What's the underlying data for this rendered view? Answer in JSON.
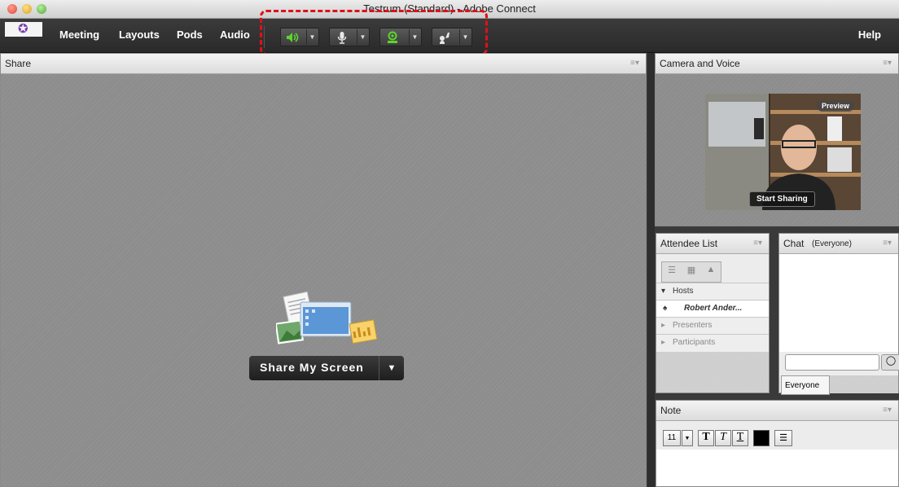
{
  "window": {
    "title": "Testrum (Standard) - Adobe Connect"
  },
  "menubar": {
    "items": [
      "Meeting",
      "Layouts",
      "Pods",
      "Audio"
    ],
    "help": "Help"
  },
  "toolbar": {
    "buttons": [
      {
        "icon": "speaker-icon",
        "active": true
      },
      {
        "icon": "microphone-icon",
        "active": false
      },
      {
        "icon": "webcam-icon",
        "active": true
      },
      {
        "icon": "raise-hand-icon",
        "active": false
      }
    ],
    "active_color": "#5cd62e"
  },
  "share": {
    "title": "Share",
    "button_label": "Share My Screen"
  },
  "camera": {
    "title": "Camera and Voice",
    "preview_label": "Preview",
    "start_label": "Start Sharing"
  },
  "attendees": {
    "title": "Attendee List",
    "groups": {
      "hosts": "Hosts",
      "host_name": "Robert Ander...",
      "presenters": "Presenters",
      "participants": "Participants"
    }
  },
  "chat": {
    "title": "Chat",
    "scope": "(Everyone)",
    "tab": "Everyone"
  },
  "note": {
    "title": "Note",
    "font_size": "11"
  }
}
